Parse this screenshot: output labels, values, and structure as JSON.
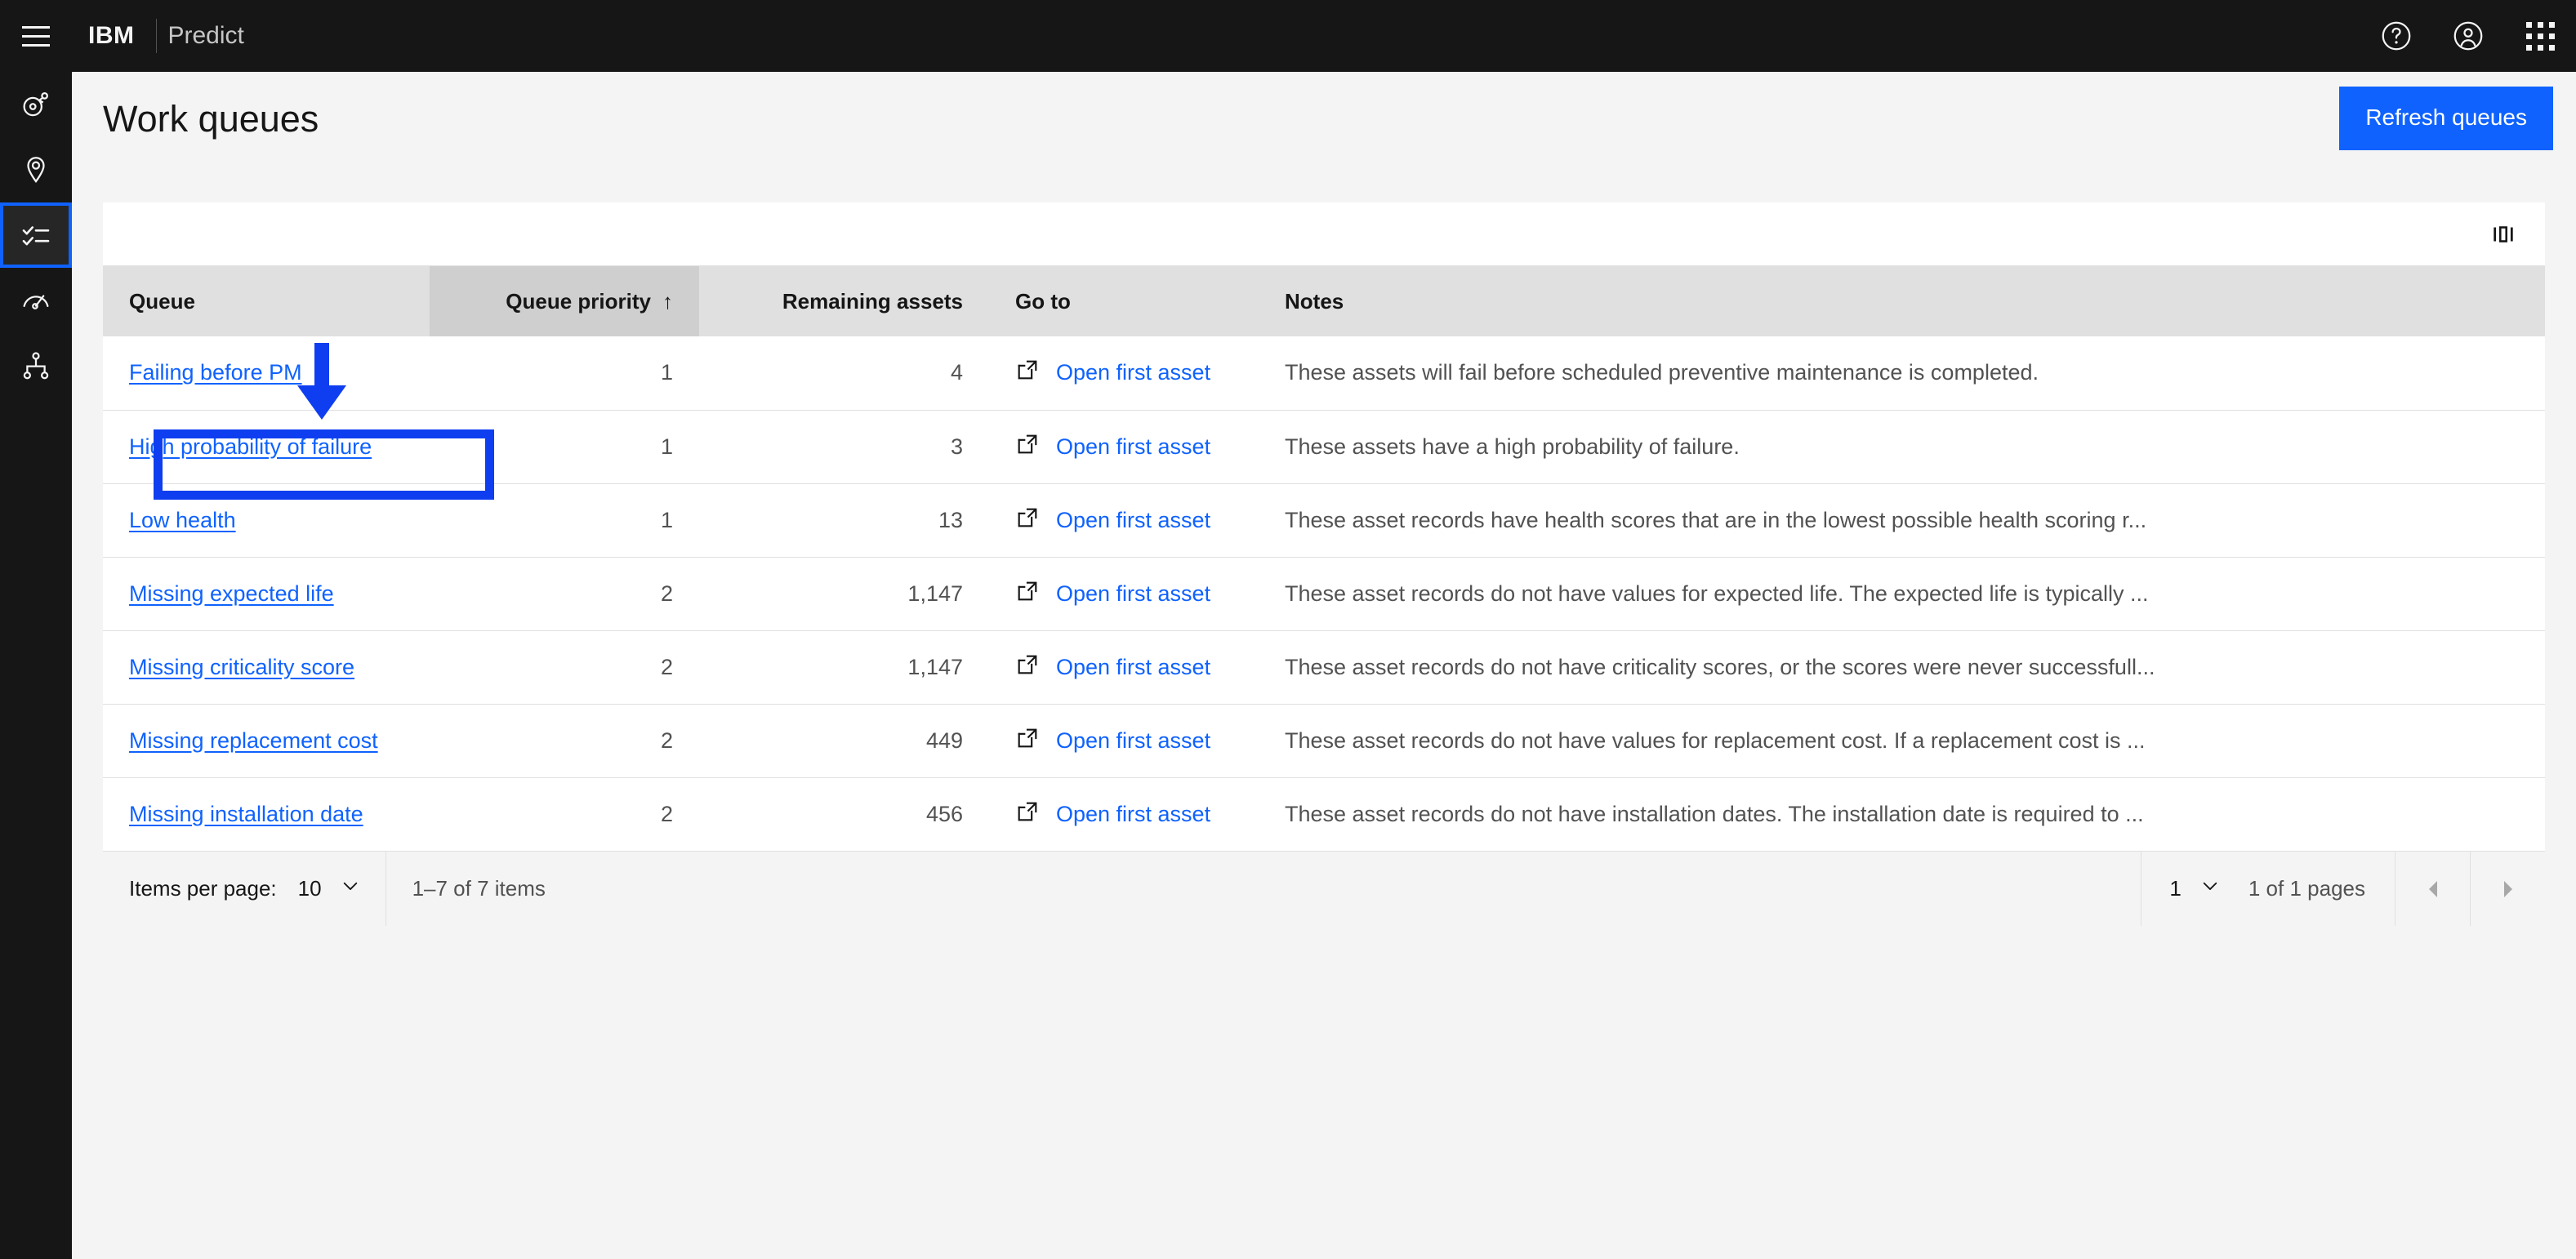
{
  "header": {
    "menu_label": "Open menu",
    "brand": "IBM",
    "app_name": "Predict",
    "icons": [
      "help-icon",
      "user-avatar-icon",
      "app-switcher-icon"
    ]
  },
  "rail": {
    "items": [
      {
        "name": "asset-icon",
        "label": "Assets"
      },
      {
        "name": "location-pin-icon",
        "label": "Locations"
      },
      {
        "name": "task-list-icon",
        "label": "Work queues",
        "selected": true
      },
      {
        "name": "gauge-icon",
        "label": "Health"
      },
      {
        "name": "hierarchy-icon",
        "label": "Hierarchy"
      }
    ]
  },
  "page": {
    "title": "Work queues",
    "refresh_label": "Refresh queues",
    "accent_color": "#0f62fe",
    "annotation_color": "#0f3ef0"
  },
  "toolbar": {
    "column_settings_icon": "column-settings-icon"
  },
  "table": {
    "columns": [
      {
        "key": "queue",
        "label": "Queue",
        "align": "left",
        "sorted": false
      },
      {
        "key": "priority",
        "label": "Queue priority",
        "align": "right",
        "sorted": true,
        "sort_arrow": "↑"
      },
      {
        "key": "remaining",
        "label": "Remaining assets",
        "align": "right",
        "sorted": false
      },
      {
        "key": "goto",
        "label": "Go to",
        "align": "left",
        "sorted": false
      },
      {
        "key": "notes",
        "label": "Notes",
        "align": "left",
        "sorted": false
      }
    ],
    "goto_label": "Open first asset",
    "rows": [
      {
        "queue": "Failing before PM",
        "priority": "1",
        "remaining": "4",
        "goto": "Open first asset",
        "notes": "These assets will fail before scheduled preventive maintenance is completed.",
        "highlighted": true
      },
      {
        "queue": "High probability of failure",
        "priority": "1",
        "remaining": "3",
        "goto": "Open first asset",
        "notes": "These assets have a high probability of failure."
      },
      {
        "queue": "Low health",
        "priority": "1",
        "remaining": "13",
        "goto": "Open first asset",
        "notes": "These asset records have health scores that are in the lowest possible health scoring r..."
      },
      {
        "queue": "Missing expected life",
        "priority": "2",
        "remaining": "1,147",
        "goto": "Open first asset",
        "notes": "These asset records do not have values for expected life. The expected life is typically ..."
      },
      {
        "queue": "Missing criticality score",
        "priority": "2",
        "remaining": "1,147",
        "goto": "Open first asset",
        "notes": "These asset records do not have criticality scores, or the scores were never successfull..."
      },
      {
        "queue": "Missing replacement cost",
        "priority": "2",
        "remaining": "449",
        "goto": "Open first asset",
        "notes": "These asset records do not have values for replacement cost. If a replacement cost is ..."
      },
      {
        "queue": "Missing installation date",
        "priority": "2",
        "remaining": "456",
        "goto": "Open first asset",
        "notes": "These asset records do not have installation dates. The installation date is required to ..."
      }
    ]
  },
  "pagination": {
    "items_per_page_label": "Items per page:",
    "items_per_page_value": "10",
    "range_text": "1–7 of 7 items",
    "page_value": "1",
    "pages_text": "1 of 1 pages",
    "prev_label": "Previous page",
    "next_label": "Next page"
  }
}
